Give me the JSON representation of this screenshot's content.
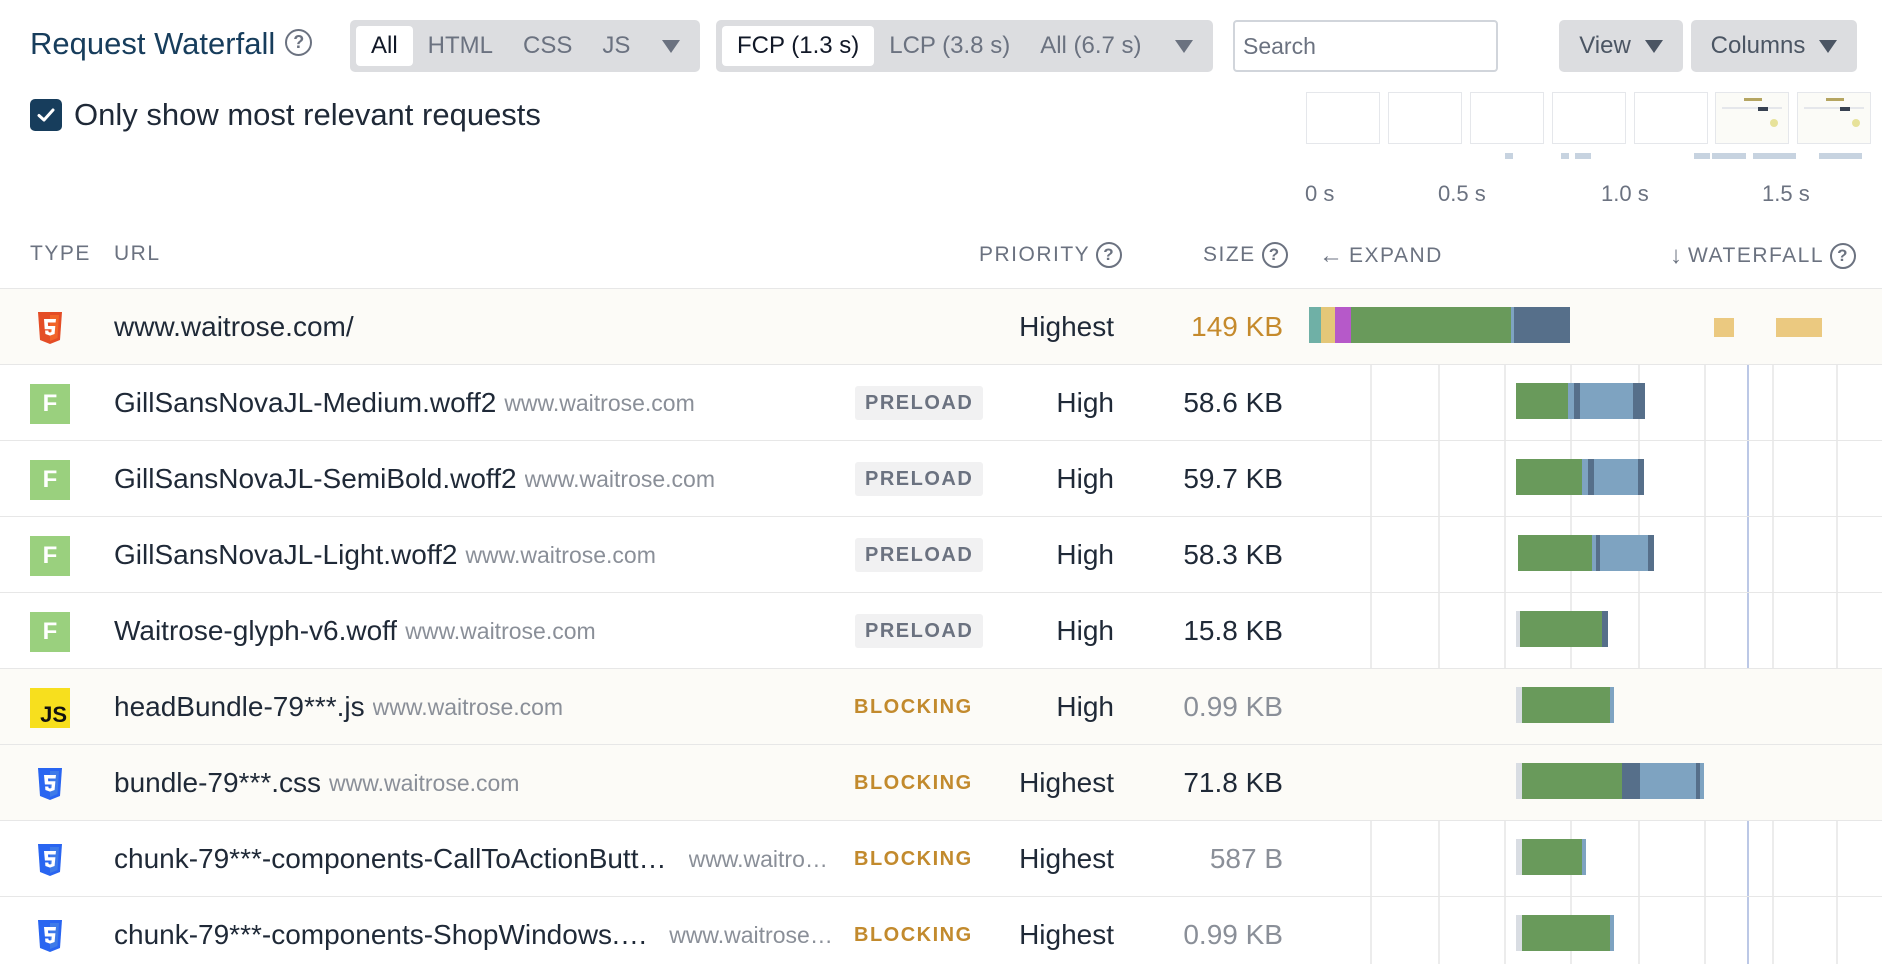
{
  "header": {
    "title": "Request Waterfall",
    "help_glyph": "?",
    "type_filters": [
      "All",
      "HTML",
      "CSS",
      "JS"
    ],
    "type_filter_active": "All",
    "metric_filters": [
      "FCP (1.3 s)",
      "LCP (3.8 s)",
      "All (6.7 s)"
    ],
    "metric_filter_active": "FCP (1.3 s)",
    "search_placeholder": "Search",
    "view_label": "View",
    "columns_label": "Columns"
  },
  "options": {
    "relevant_label": "Only show most relevant requests",
    "relevant_checked": true
  },
  "timeline": {
    "ticks": [
      "0 s",
      "0.5 s",
      "1.0 s",
      "1.5 s"
    ],
    "frames": 7
  },
  "columns": {
    "type": "TYPE",
    "url": "URL",
    "priority": "PRIORITY",
    "size": "SIZE",
    "expand": "EXPAND",
    "waterfall": "WATERFALL",
    "expand_arrow": "←",
    "waterfall_arrow": "↓"
  },
  "colors": {
    "brand": "#173d5c",
    "html": "#e44d26",
    "css": "#2965f1",
    "font": "#9ad07e",
    "js": "#f7df1e",
    "blocking": "#c28a2d",
    "download": "#699a5b",
    "wait": "#7ea3c1",
    "dark": "#566f8a"
  },
  "requests": [
    {
      "type": "html",
      "icon": "html5-icon",
      "name": "www.waitrose.com/",
      "host": "",
      "badge": "",
      "priority": "Highest",
      "size": "149 KB",
      "size_style": "gold",
      "highlight": true
    },
    {
      "type": "font",
      "icon": "font-icon",
      "icon_text": "F",
      "name": "GillSansNovaJL-Medium.woff2",
      "host": "www.waitrose.com",
      "badge": "PRELOAD",
      "priority": "High",
      "size": "58.6 KB",
      "size_style": "",
      "highlight": false
    },
    {
      "type": "font",
      "icon": "font-icon",
      "icon_text": "F",
      "name": "GillSansNovaJL-SemiBold.woff2",
      "host": "www.waitrose.com",
      "badge": "PRELOAD",
      "priority": "High",
      "size": "59.7 KB",
      "size_style": "",
      "highlight": false
    },
    {
      "type": "font",
      "icon": "font-icon",
      "icon_text": "F",
      "name": "GillSansNovaJL-Light.woff2",
      "host": "www.waitrose.com",
      "badge": "PRELOAD",
      "priority": "High",
      "size": "58.3 KB",
      "size_style": "",
      "highlight": false
    },
    {
      "type": "font",
      "icon": "font-icon",
      "icon_text": "F",
      "name": "Waitrose-glyph-v6.woff",
      "host": "www.waitrose.com",
      "badge": "PRELOAD",
      "priority": "High",
      "size": "15.8 KB",
      "size_style": "",
      "highlight": false
    },
    {
      "type": "js",
      "icon": "js-icon",
      "icon_text": "JS",
      "name": "headBundle-79***.js",
      "host": "www.waitrose.com",
      "badge": "BLOCKING",
      "priority": "High",
      "size": "0.99 KB",
      "size_style": "muted",
      "highlight": true
    },
    {
      "type": "css",
      "icon": "css3-icon",
      "name": "bundle-79***.css",
      "host": "www.waitrose.com",
      "badge": "BLOCKING",
      "priority": "Highest",
      "size": "71.8 KB",
      "size_style": "",
      "highlight": true
    },
    {
      "type": "css",
      "icon": "css3-icon",
      "name": "chunk-79***-components-CallToActionButto…",
      "host": "www.waitros…",
      "badge": "BLOCKING",
      "priority": "Highest",
      "size": "587 B",
      "size_style": "muted",
      "highlight": false
    },
    {
      "type": "css",
      "icon": "css3-icon",
      "name": "chunk-79***-components-ShopWindows.css",
      "host": "www.waitrose.…",
      "badge": "BLOCKING",
      "priority": "Highest",
      "size": "0.99 KB",
      "size_style": "muted",
      "highlight": false
    }
  ]
}
